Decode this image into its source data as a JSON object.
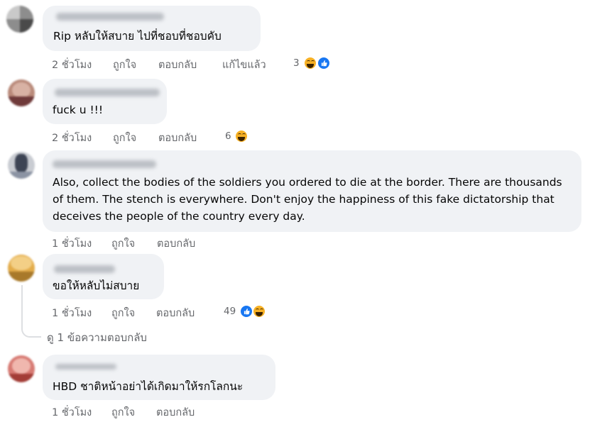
{
  "comments": [
    {
      "text": "Rip หลับให้สบาย ไปที่ชอบที่ชอบคับ",
      "actions": {
        "time": "2 ชั่วโมง",
        "like": "ถูกใจ",
        "reply": "ตอบกลับ",
        "edited": "แก้ไขแล้ว"
      },
      "reactions": {
        "count": "3",
        "icons": [
          "haha-reaction-icon",
          "like-reaction-icon"
        ]
      }
    },
    {
      "text": "fuck u !!!",
      "actions": {
        "time": "2 ชั่วโมง",
        "like": "ถูกใจ",
        "reply": "ตอบกลับ"
      },
      "reactions": {
        "count": "6",
        "icons": [
          "haha-reaction-icon"
        ]
      }
    },
    {
      "text": "Also, collect the bodies of the soldiers you ordered to die at the border. There are thousands of them. The stench is everywhere. Don't enjoy the happiness of this fake dictatorship that deceives the people of the country every day.",
      "actions": {
        "time": "1 ชั่วโมง",
        "like": "ถูกใจ",
        "reply": "ตอบกลับ"
      }
    },
    {
      "text": "ขอให้หลับไม่สบาย",
      "actions": {
        "time": "1 ชั่วโมง",
        "like": "ถูกใจ",
        "reply": "ตอบกลับ"
      },
      "reactions": {
        "count": "49",
        "icons": [
          "like-reaction-icon",
          "haha-reaction-icon"
        ]
      },
      "replies_link": "ดู 1 ข้อความตอบกลับ"
    },
    {
      "text": "HBD ชาติหน้าอย่าได้เกิดมาให้รกโลกนะ",
      "actions": {
        "time": "1 ชั่วโมง",
        "like": "ถูกใจ",
        "reply": "ตอบกลับ"
      }
    }
  ],
  "colors": {
    "bubble": "#f0f2f5",
    "meta_text": "#65676b",
    "like_blue": "#1877f2",
    "haha_yellow": "#f7b125"
  }
}
